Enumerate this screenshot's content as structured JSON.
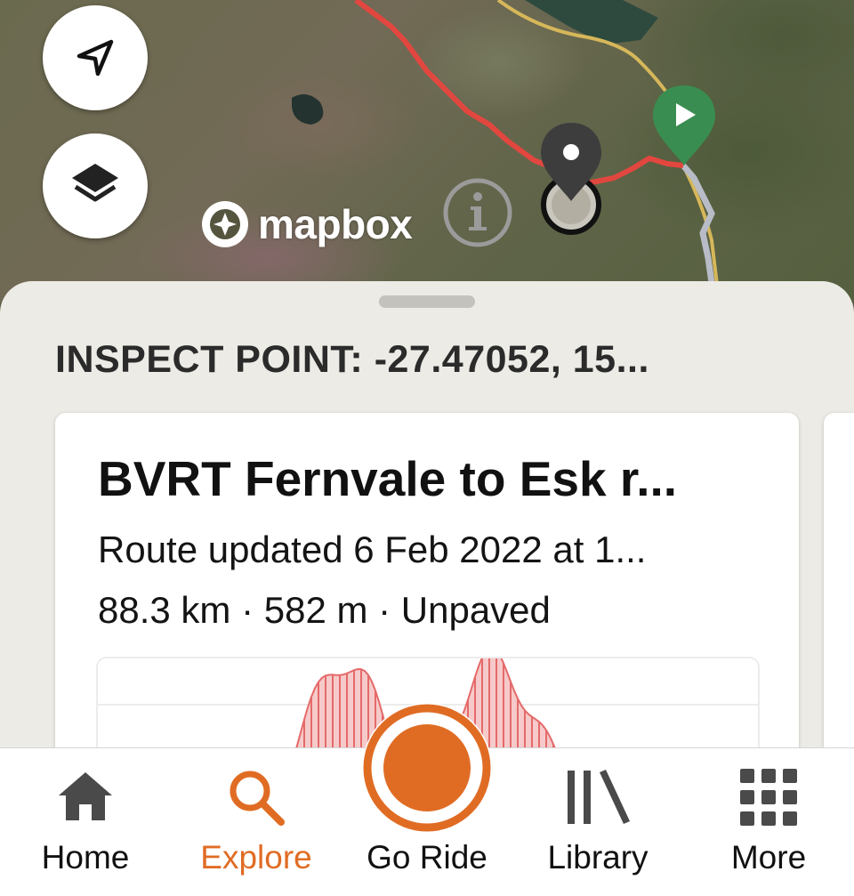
{
  "map": {
    "attribution_logo": "mapbox",
    "route_color": "#e2473f",
    "alt_route_color": "#b8bcc6",
    "road_color": "#d6b75a",
    "start_marker_color": "#3a8d50",
    "point_marker_color": "#3d3d3d",
    "controls": {
      "locate_icon": "navigation-arrow-icon",
      "layers_icon": "layers-icon",
      "info_icon": "info-icon"
    }
  },
  "sheet": {
    "title": "INSPECT POINT: -27.47052, 15...",
    "card": {
      "name": "BVRT Fernvale to Esk r...",
      "updated": "Route updated 6 Feb 2022 at 1...",
      "stats": "88.3 km · 582 m · Unpaved",
      "elevation_color": "#e56a6a"
    }
  },
  "tabs": [
    {
      "label": "Home",
      "icon": "home-icon",
      "active": false
    },
    {
      "label": "Explore",
      "icon": "search-icon",
      "active": true
    },
    {
      "label": "Go Ride",
      "icon": "record-icon",
      "active": false
    },
    {
      "label": "Library",
      "icon": "library-icon",
      "active": false
    },
    {
      "label": "More",
      "icon": "grid-icon",
      "active": false
    }
  ],
  "accent_color": "#e06c24"
}
